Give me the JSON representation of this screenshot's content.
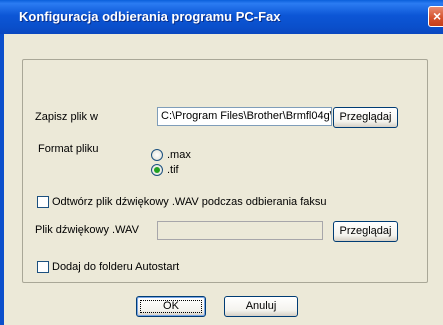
{
  "window": {
    "title": "Konfiguracja odbierania programu PC-Fax",
    "close_glyph": "×"
  },
  "save_to": {
    "label": "Zapisz plik w",
    "value": "C:\\Program Files\\Brother\\Brmfl04g\\F",
    "browse_label": "Przeglądaj"
  },
  "file_format": {
    "label": "Format pliku",
    "options": [
      {
        "label": ".max",
        "selected": false
      },
      {
        "label": ".tif",
        "selected": true
      }
    ]
  },
  "play_sound": {
    "label": "Odtwórz plik dźwiękowy .WAV podczas odbierania faksu",
    "checked": false
  },
  "wav_file": {
    "label": "Plik dźwiękowy .WAV",
    "value": "",
    "browse_label": "Przeglądaj"
  },
  "autostart": {
    "label": "Dodaj do folderu Autostart",
    "checked": false
  },
  "buttons": {
    "ok": "OK",
    "cancel": "Anuluj"
  }
}
